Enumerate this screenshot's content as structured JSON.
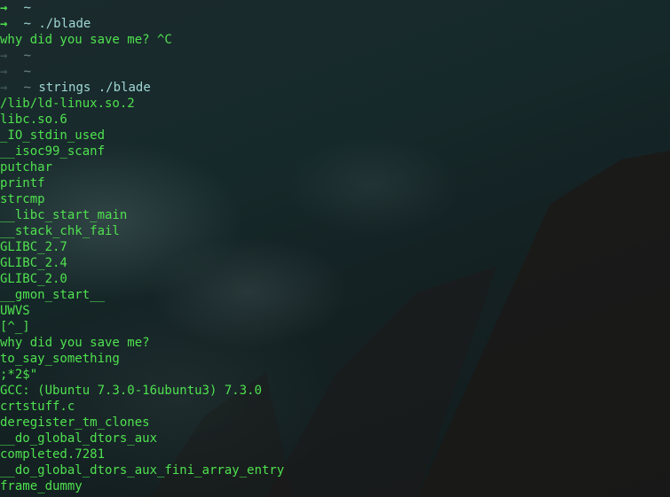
{
  "terminal": {
    "lines": [
      {
        "type": "prompt",
        "status": "ok",
        "cwd": "~",
        "cmd": ""
      },
      {
        "type": "prompt",
        "status": "ok",
        "cwd": "~",
        "cmd": "./blade"
      },
      {
        "type": "output",
        "text": "why did you save me? ^C"
      },
      {
        "type": "prompt",
        "status": "err",
        "cwd": "~",
        "cmd": ""
      },
      {
        "type": "prompt",
        "status": "err",
        "cwd": "~",
        "cmd": ""
      },
      {
        "type": "prompt",
        "status": "err",
        "cwd": "~",
        "cmd": "strings ./blade"
      },
      {
        "type": "output",
        "text": "/lib/ld-linux.so.2"
      },
      {
        "type": "output",
        "text": "libc.so.6"
      },
      {
        "type": "output",
        "text": "_IO_stdin_used"
      },
      {
        "type": "output",
        "text": "__isoc99_scanf"
      },
      {
        "type": "output",
        "text": "putchar"
      },
      {
        "type": "output",
        "text": "printf"
      },
      {
        "type": "output",
        "text": "strcmp"
      },
      {
        "type": "output",
        "text": "__libc_start_main"
      },
      {
        "type": "output",
        "text": "__stack_chk_fail"
      },
      {
        "type": "output",
        "text": "GLIBC_2.7"
      },
      {
        "type": "output",
        "text": "GLIBC_2.4"
      },
      {
        "type": "output",
        "text": "GLIBC_2.0"
      },
      {
        "type": "output",
        "text": "__gmon_start__"
      },
      {
        "type": "output",
        "text": "UWVS"
      },
      {
        "type": "output",
        "text": "[^_]"
      },
      {
        "type": "output",
        "text": "why did you save me?"
      },
      {
        "type": "output",
        "text": "to_say_something"
      },
      {
        "type": "output",
        "text": ";*2$\""
      },
      {
        "type": "output",
        "text": "GCC: (Ubuntu 7.3.0-16ubuntu3) 7.3.0"
      },
      {
        "type": "output",
        "text": "crtstuff.c"
      },
      {
        "type": "output",
        "text": "deregister_tm_clones"
      },
      {
        "type": "output",
        "text": "__do_global_dtors_aux"
      },
      {
        "type": "output",
        "text": "completed.7281"
      },
      {
        "type": "output",
        "text": "__do_global_dtors_aux_fini_array_entry"
      },
      {
        "type": "output",
        "text": "frame_dummy"
      }
    ]
  },
  "icons": {
    "prompt_arrow": "→"
  },
  "colors": {
    "output": "#4fe14f",
    "prompt_ok": "#4fe14f",
    "prompt_err": "#3f5353",
    "cwd": "#9fd7d3"
  }
}
